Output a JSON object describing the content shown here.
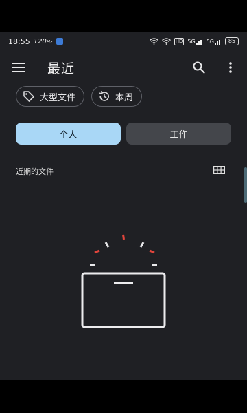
{
  "status_bar": {
    "time": "18:55",
    "rate": "120",
    "rate_unit": "Hz",
    "net1": "5G",
    "net2": "5G",
    "battery": "85",
    "app_icon": "notification-icon"
  },
  "app_bar": {
    "title": "最近",
    "menu_icon": "menu-icon",
    "search_icon": "search-icon",
    "more_icon": "more-vert-icon"
  },
  "filters": {
    "chip_large_files": "大型文件",
    "chip_this_week": "本周",
    "chip_large_files_icon": "tag-icon",
    "chip_this_week_icon": "history-icon"
  },
  "tabs": {
    "personal": "个人",
    "work": "工作",
    "selected": "personal"
  },
  "section": {
    "label": "近期的文件",
    "view_icon": "grid-view-icon"
  },
  "empty_state": {
    "illustration": "empty-box-illustration"
  },
  "colors": {
    "background": "#1f2024",
    "tab_selected": "#a9d7f6",
    "tab_unselected": "#44464b",
    "accent_red": "#e0453c"
  }
}
